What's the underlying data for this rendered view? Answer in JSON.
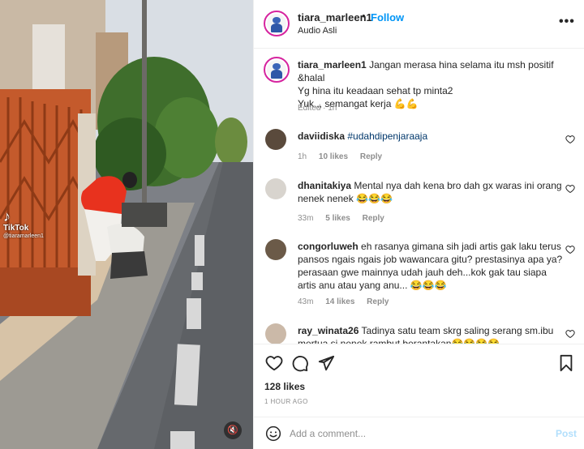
{
  "media": {
    "watermark_logo": "TikTok",
    "watermark_handle": "@tiaramarleen1"
  },
  "header": {
    "username": "tiara_marleen1",
    "separator": "•",
    "follow_label": "Follow",
    "audio_label": "Audio Asli",
    "more_label": "•••"
  },
  "caption": {
    "username": "tiara_marleen1",
    "line1": "Jangan merasa hina selama itu msh positif &halal",
    "line2": "Yg hina itu keadaan sehat tp minta2",
    "line3": "Yuk,,, semangat kerja 💪💪",
    "meta": "Edited · 1h"
  },
  "comments": [
    {
      "username": "daviidiska",
      "text": "#udahdipenjaraaja",
      "time": "1h",
      "likes": "10 likes",
      "reply": "Reply"
    },
    {
      "username": "dhanitakiya",
      "text": "Mental nya dah kena bro dah gx waras ini orang nenek nenek 😂😂😂",
      "time": "33m",
      "likes": "5 likes",
      "reply": "Reply"
    },
    {
      "username": "congorluweh",
      "text": "eh rasanya gimana sih jadi artis gak laku terus pansos ngais ngais job wawancara gitu? prestasinya apa ya? perasaan gwe mainnya udah jauh deh...kok gak tau siapa artis anu atau yang anu... 😂😂😂",
      "time": "43m",
      "likes": "14 likes",
      "reply": "Reply"
    },
    {
      "username": "ray_winata26",
      "text": "Tadinya satu team skrg saling serang sm.ibu mertua si nenek rambut berantakan😂😂😂😂",
      "time": "",
      "likes": "",
      "reply": ""
    }
  ],
  "actions": {
    "likes_count": "128 likes",
    "time_ago": "1 HOUR AGO"
  },
  "add_comment": {
    "placeholder": "Add a comment...",
    "post_label": "Post"
  },
  "colors": {
    "accent": "#0095f6",
    "post_disabled": "#b2dffc",
    "gate": "#c45a2c",
    "shirt": "#e8321e"
  }
}
